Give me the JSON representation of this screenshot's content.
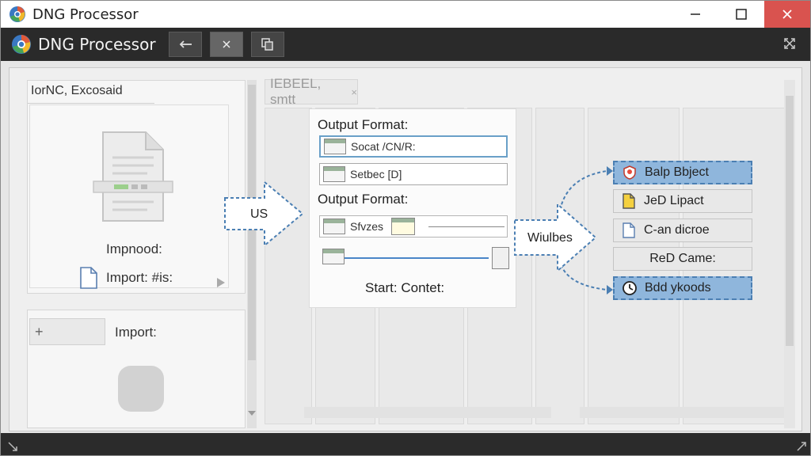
{
  "os": {
    "title": "DNG Processor",
    "icon": "app-globe-icon",
    "controls": [
      "minimize-icon",
      "maximize-icon",
      "close-icon"
    ],
    "close_color": "#d9534f"
  },
  "toolbar": {
    "title": "DNG Processor",
    "buttons": [
      "back-arrow-icon",
      "close-x-icon",
      "copy-icon"
    ],
    "expand_icon": "expand-arrows-icon"
  },
  "left_panel": {
    "title": "IorNC, Excosaid",
    "card": {
      "heading": "Impnood:",
      "file_label": "Import: #is:"
    },
    "lower": {
      "header_icon": "+",
      "label": "Import:"
    }
  },
  "center": {
    "tab_label": "IEBEEL, smtt",
    "tab_close": "×",
    "dialog": {
      "label1": "Output Format:",
      "field1": "Socat /CN/R:",
      "field2": "Setbec [D]",
      "label2": "Output Format:",
      "field3": "Sfvzes",
      "start_label": "Start:  Contet:"
    }
  },
  "arrows": {
    "left_label": "US",
    "right_label": "Wiulbes"
  },
  "outputs": [
    {
      "label": "Balp Bbject",
      "icon": "shield-icon",
      "selected": true
    },
    {
      "label": "JeD Lipact",
      "icon": "yellow-doc-icon",
      "selected": false
    },
    {
      "label": "C-an dicroe",
      "icon": "doc-icon",
      "selected": false
    },
    {
      "label": "ReD Came:",
      "icon": "",
      "selected": false
    },
    {
      "label": "Bdd ykoods",
      "icon": "clock-icon",
      "selected": true
    }
  ],
  "colors": {
    "toolbar_bg": "#2a2a2a",
    "accent_blue": "#4b7fb3",
    "selection_blue": "#8fb6dc"
  }
}
